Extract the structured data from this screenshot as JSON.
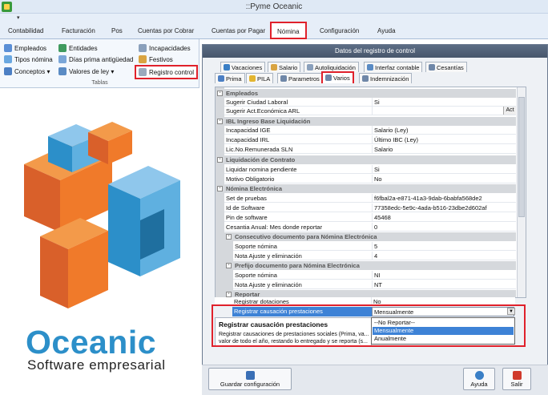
{
  "window": {
    "title": "::Pyme Oceanic",
    "qat_arrow": "▾"
  },
  "ribbon": {
    "tabs": [
      "Contabilidad",
      "Facturación",
      "Pos",
      "Cuentas por Cobrar",
      "Cuentas por Pagar",
      "Nómina",
      "Configuración",
      "Ayuda"
    ],
    "active_tab": "Nómina",
    "items": {
      "empleados": "Empleados",
      "tipos_nomina": "Tipos nómina",
      "conceptos": "Conceptos",
      "entidades": "Entidades",
      "dias_prima": "Días prima antigüedad",
      "valores_ley": "Valores de ley",
      "incapacidades": "Incapacidades",
      "festivos": "Festivos",
      "registro_control": "Registro control"
    },
    "group_label": "Tablas",
    "dropdown_arrow": "▾"
  },
  "brand": {
    "name": "Oceanic",
    "tagline": "Software empresarial"
  },
  "dialog": {
    "title": "Datos del registro de control",
    "tabs_row1": [
      "Vacaciones",
      "Salario",
      "Autoliquidación",
      "Interfaz contable",
      "Cesantías"
    ],
    "tabs_row2": [
      "Prima",
      "PILA",
      "Parametros",
      "Varios",
      "Indemnización"
    ],
    "active_tab": "Varios",
    "grid": {
      "rows": [
        {
          "type": "cat",
          "label": "Empleados",
          "toggle": "-"
        },
        {
          "type": "item",
          "label": "Sugerir Ciudad Laboral",
          "value": "Si"
        },
        {
          "type": "item",
          "label": "Sugerir Act.Económica ARL",
          "value": "",
          "button": "Act"
        },
        {
          "type": "cat",
          "label": "IBL Ingreso Base Liquidación",
          "toggle": "-"
        },
        {
          "type": "item",
          "label": "Incapacidad IGE",
          "value": "Salario      (Ley)"
        },
        {
          "type": "item",
          "label": "Incapacidad IRL",
          "value": "Último IBC      (Ley)"
        },
        {
          "type": "item",
          "label": "Lic.No.Remunerada SLN",
          "value": "Salario"
        },
        {
          "type": "cat",
          "label": "Liquidación de Contrato",
          "toggle": "-"
        },
        {
          "type": "item",
          "label": "Liquidar nomina pendiente",
          "value": "Si"
        },
        {
          "type": "item",
          "label": "Motivo Obligatorio",
          "value": "No"
        },
        {
          "type": "cat",
          "label": "Nómina Electrónica",
          "toggle": "-"
        },
        {
          "type": "item",
          "label": "Set de pruebas",
          "value": "f6fbal2a-e871-41a3-9dab-6babfa568de2"
        },
        {
          "type": "item",
          "label": "Id de Software",
          "value": "77358edc-5e9c-4ada-b516-23dbe2d602af"
        },
        {
          "type": "item",
          "label": "Pin de software",
          "value": "45468"
        },
        {
          "type": "item",
          "label": "Cesantia Anual: Mes donde reportar",
          "value": "0"
        },
        {
          "type": "subcat",
          "label": "Consecutivo documento para Nómina Electrónica",
          "toggle": "-"
        },
        {
          "type": "sub",
          "label": "Soporte nómina",
          "value": "5"
        },
        {
          "type": "sub",
          "label": "Nota Ajuste y eliminación",
          "value": "4"
        },
        {
          "type": "subcat",
          "label": "Prefijo documento para Nómina Electrónica",
          "toggle": "-"
        },
        {
          "type": "sub",
          "label": "Soporte nómina",
          "value": "NI"
        },
        {
          "type": "sub",
          "label": "Nota Ajuste y eliminación",
          "value": "NT"
        },
        {
          "type": "subcat",
          "label": "Reportar",
          "toggle": "-"
        },
        {
          "type": "sub",
          "label": "Registrar dotaciones",
          "value": "No"
        }
      ],
      "selected_row": {
        "label": "Registrar causación prestaciones",
        "value": "Mensualmente"
      }
    },
    "description": {
      "title": "Registrar causación prestaciones",
      "text": "Registrar causaciones de prestaciones sociales (Prima, va... valor de todo el año, restando lo entregado y se reporta (s..."
    },
    "dropdown": {
      "options": [
        "--No Reportar--",
        "Mensualmente",
        "Anualmente"
      ],
      "selected": "Mensualmente",
      "arrow": "▼"
    },
    "buttons": {
      "save": "Guardar configuración",
      "help": "Ayuda",
      "exit": "Salir"
    }
  },
  "colors": {
    "accent_red": "#e0212b",
    "selection_blue": "#3d82d6",
    "brand_blue": "#2c8fc9",
    "brand_orange": "#f07a2a"
  }
}
